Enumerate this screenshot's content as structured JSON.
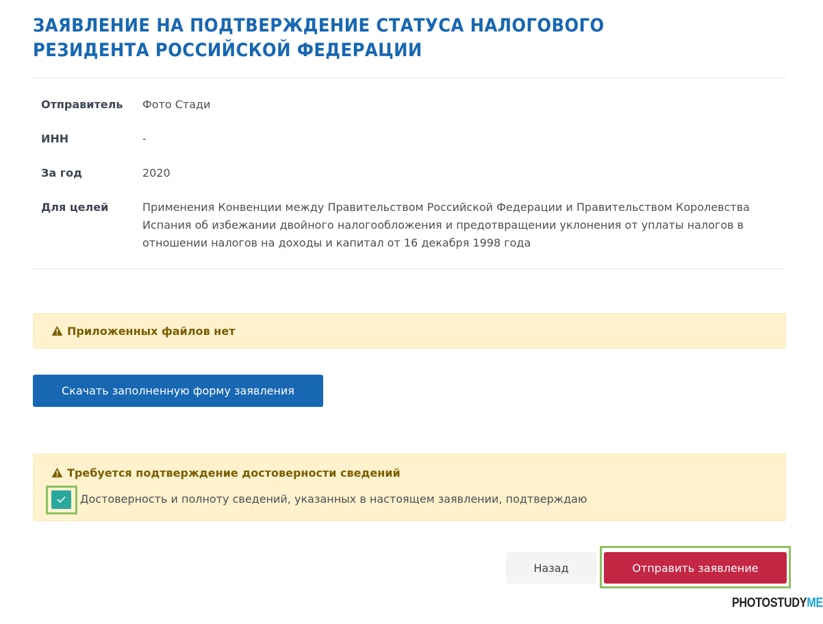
{
  "header": {
    "title": "ЗАЯВЛЕНИЕ НА ПОДТВЕРЖДЕНИЕ СТАТУСА НАЛОГОВОГО РЕЗИДЕНТА РОССИЙСКОЙ ФЕДЕРАЦИИ"
  },
  "details": [
    {
      "label": "Отправитель",
      "value": "Фото Стади"
    },
    {
      "label": "ИНН",
      "value": "-"
    },
    {
      "label": "За год",
      "value": "2020"
    },
    {
      "label": "Для целей",
      "value": "Применения Конвенции между Правительством Российской Федерации и Правительством Королевства Испания об избежании двойного налогообложения и предотвращении уклонения от уплаты налогов в отношении налогов на доходы и капитал от 16 декабря 1998 года"
    }
  ],
  "attachments_alert": {
    "icon": "warning-icon",
    "text": "Приложенных файлов нет"
  },
  "download_button": {
    "label": "Скачать заполненную форму заявления"
  },
  "confirmation": {
    "icon": "warning-icon",
    "title": "Требуется подтверждение достоверности сведений",
    "checkbox_label": "Достоверность и полноту сведений, указанных в настоящем заявлении, подтверждаю",
    "checked": true
  },
  "actions": {
    "back_label": "Назад",
    "submit_label": "Отправить заявление"
  },
  "watermark": {
    "part1": "PHOTOSTUDY",
    "part2": "ME"
  },
  "colors": {
    "title_blue": "#1767b2",
    "primary_button": "#1767b2",
    "submit_button": "#c32743",
    "alert_background": "#fff2cc",
    "alert_text": "#7a5d00",
    "checkbox": "#2aa79d",
    "highlight_frame": "#8cc163"
  }
}
